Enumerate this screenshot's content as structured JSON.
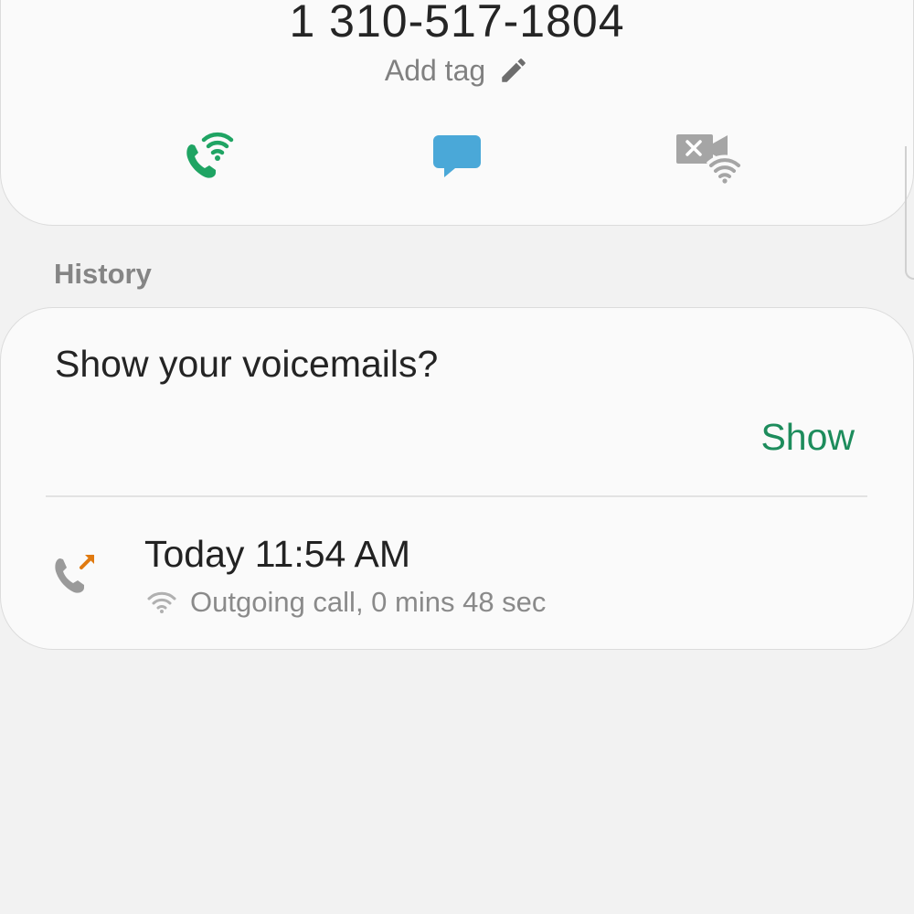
{
  "contact": {
    "phone_number": "1 310-517-1804",
    "add_tag_label": "Add tag",
    "actions": [
      {
        "name": "wifi-call",
        "icon": "wifi-call-icon",
        "color": "#1fa463"
      },
      {
        "name": "message",
        "icon": "message-icon",
        "color": "#4aa8d8"
      },
      {
        "name": "video-call",
        "icon": "video-call-disabled-icon",
        "color": "#a5a5a5"
      }
    ]
  },
  "history": {
    "heading": "History",
    "voicemail_prompt": "Show your voicemails?",
    "show_label": "Show",
    "show_color": "#1d8c5c",
    "calls": [
      {
        "time": "Today 11:54 AM",
        "detail": "Outgoing call, 0 mins 48 sec",
        "type_icon": "outgoing-call-icon",
        "arrow_color": "#e07a10",
        "network_icon": "wifi-icon"
      }
    ]
  },
  "colors": {
    "background": "#f2f2f2",
    "card": "#fafafa",
    "text_primary": "#222222",
    "text_secondary": "#8a8a8a"
  }
}
